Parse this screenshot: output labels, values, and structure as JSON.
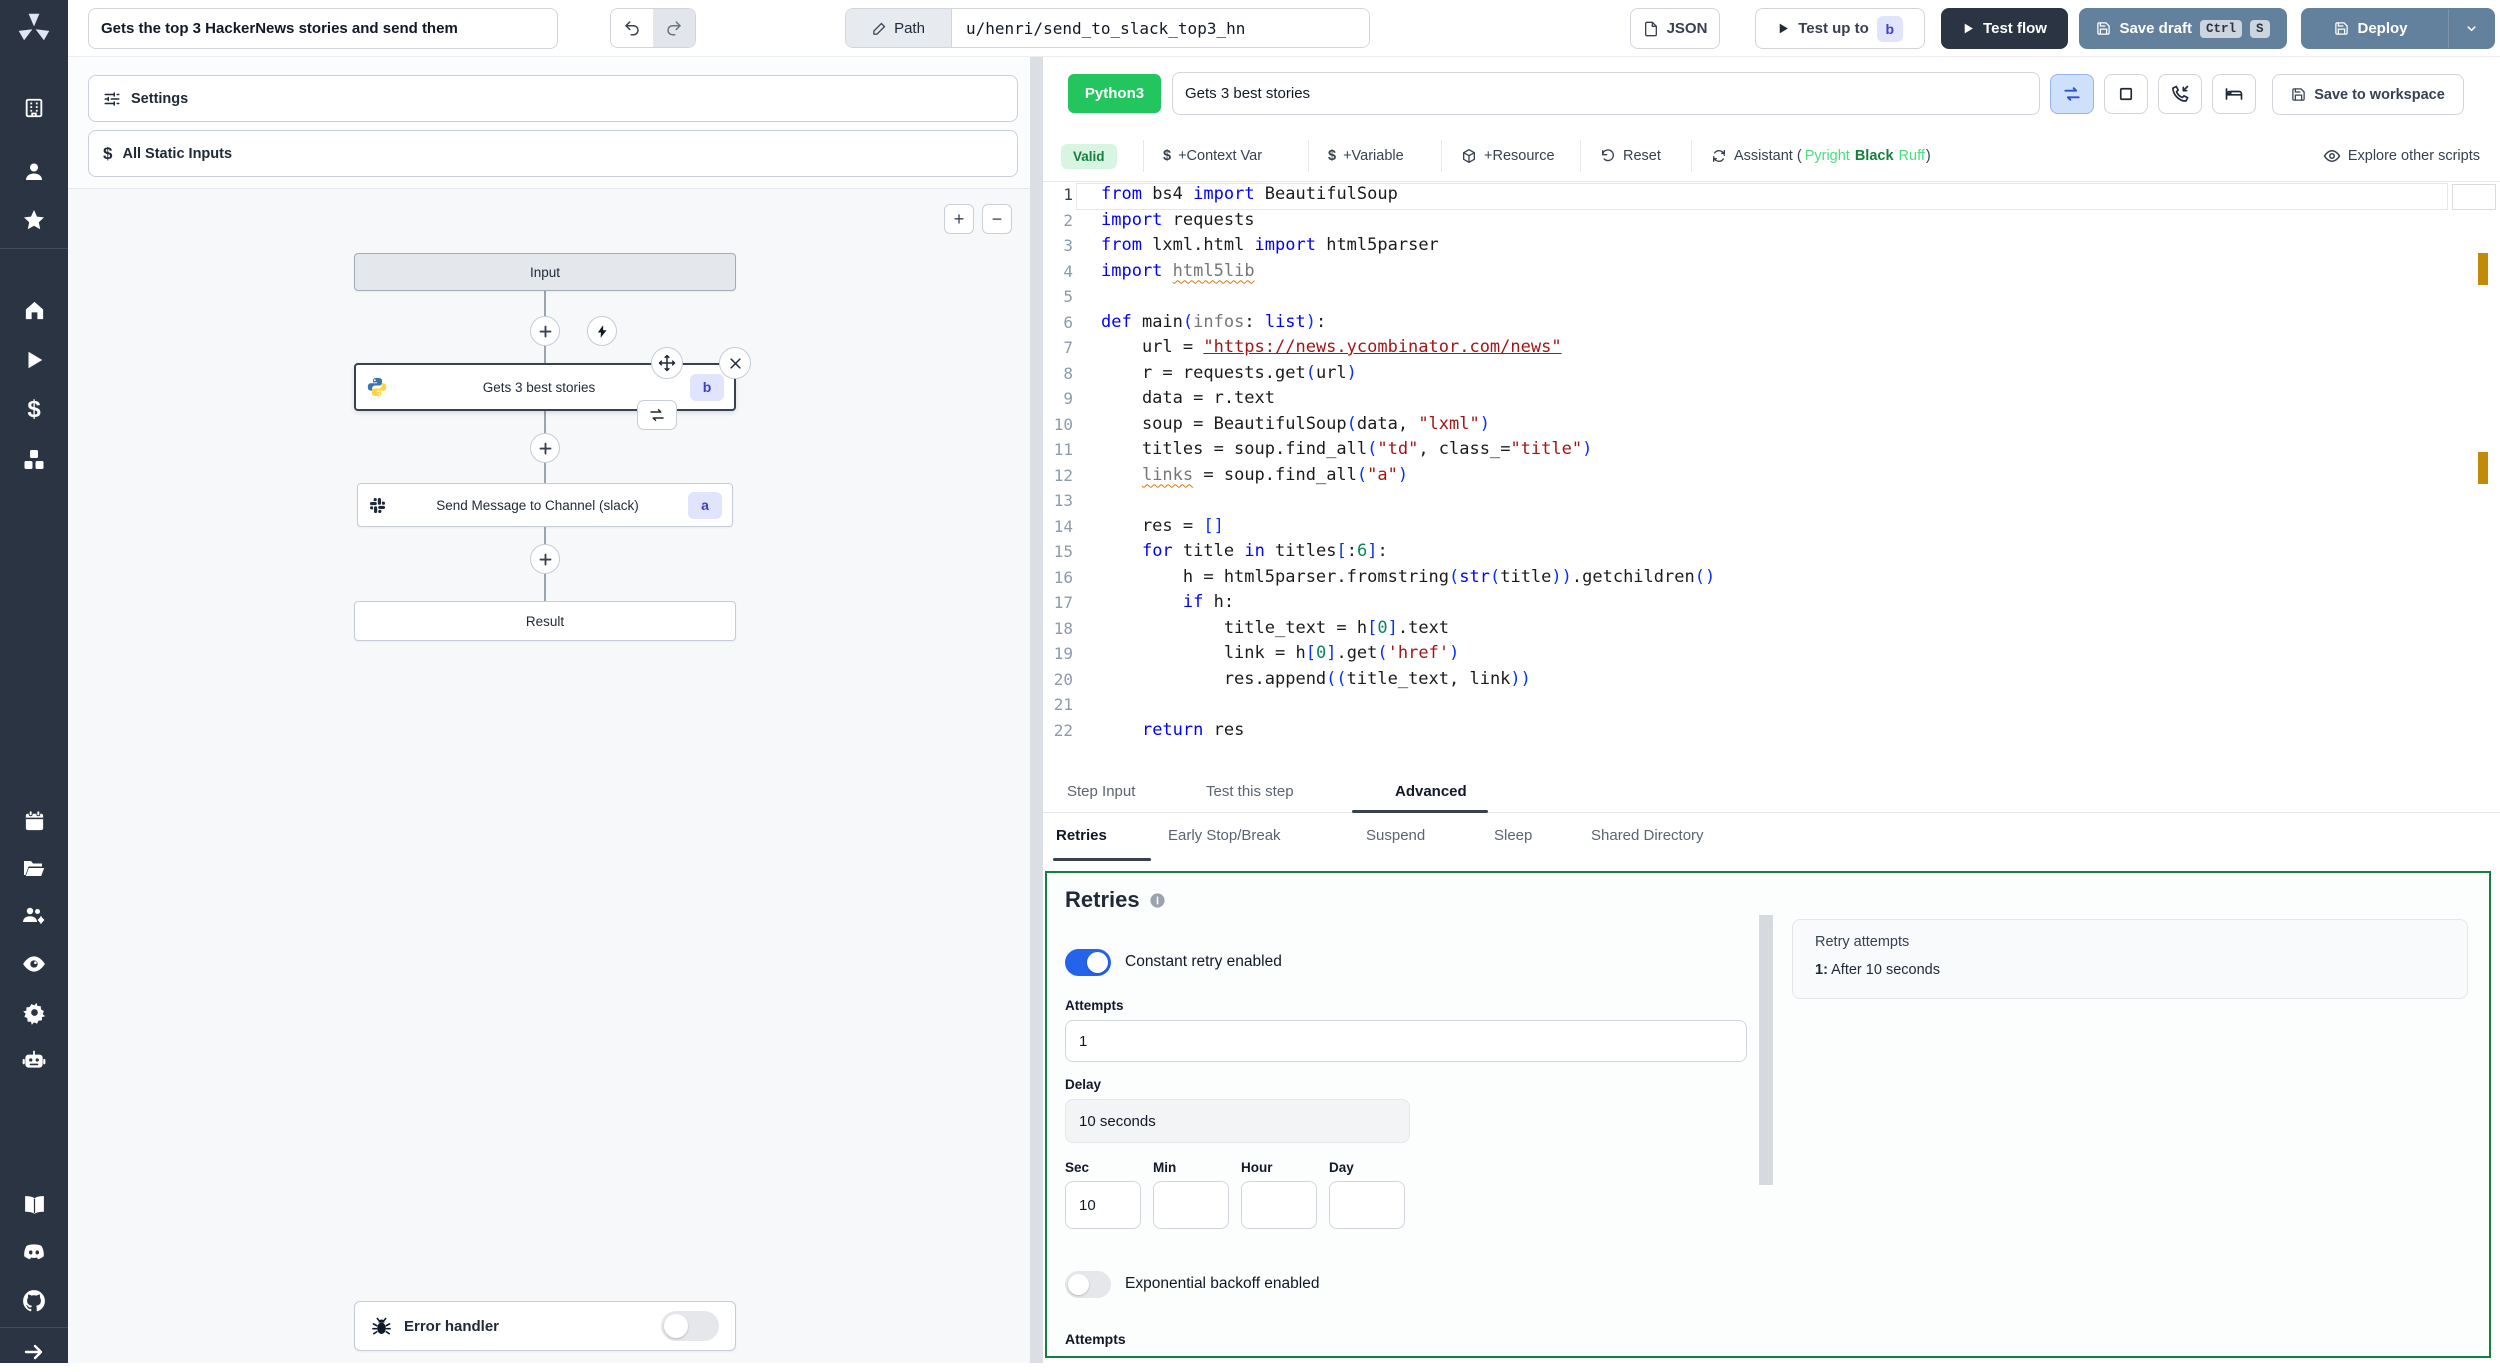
{
  "colors": {
    "accent_green": "#15803d",
    "python_badge_green": "#22c55e",
    "toggle_blue": "#2563eb",
    "steel_button": "#63809c",
    "dark_navy": "#2b3442",
    "badge_indigo_bg": "#e0e4fc",
    "badge_indigo_text": "#4040c8",
    "warning_amber": "#bf8803",
    "valid_bg": "#d8f5e3",
    "valid_text": "#15803d"
  },
  "sidebar": {
    "icons": [
      "windmill-logo",
      "building-icon",
      "user-icon",
      "star-icon",
      "home-icon",
      "play-icon",
      "dollar-icon",
      "cubes-icon",
      "calendar-icon",
      "folder-icon",
      "user-group-gear-icon",
      "eye-icon",
      "gear-icon",
      "robot-icon",
      "book-icon",
      "discord-icon",
      "github-icon",
      "arrow-right-icon"
    ]
  },
  "topbar": {
    "flow_title": "Gets the top 3 HackerNews stories and send them",
    "path_label": "Path",
    "path_value": "u/henri/send_to_slack_top3_hn",
    "json_button": "JSON",
    "test_up_to": "Test up to",
    "test_up_to_badge": "b",
    "test_flow": "Test flow",
    "save_draft": "Save draft",
    "kbd": [
      "Ctrl",
      "S"
    ],
    "deploy": "Deploy"
  },
  "flow": {
    "settings_label": "Settings",
    "static_inputs_label": "All Static Inputs",
    "zoom_in": "+",
    "zoom_out": "−",
    "nodes": {
      "input": "Input",
      "step_b": {
        "label": "Gets 3 best stories",
        "badge": "b"
      },
      "step_a": {
        "label": "Send Message to Channel (slack)",
        "badge": "a"
      },
      "result": "Result",
      "error_handler": "Error handler"
    }
  },
  "editor": {
    "language": "Python3",
    "step_name": "Gets 3 best stories",
    "save_to_workspace": "Save to workspace",
    "toolbar": {
      "valid": "Valid",
      "context_var": "+Context Var",
      "variable": "+Variable",
      "resource": "+Resource",
      "reset": "Reset",
      "assistant_prefix": "Assistant (",
      "assistant_tools": [
        "Pyright",
        "Black",
        "Ruff"
      ],
      "assistant_suffix": ")",
      "explore": "Explore other scripts"
    },
    "code_lines": [
      [
        [
          "k",
          "from"
        ],
        [
          "p",
          " bs4 "
        ],
        [
          "k",
          "import"
        ],
        [
          "p",
          " BeautifulSoup"
        ]
      ],
      [
        [
          "k",
          "import"
        ],
        [
          "p",
          " requests"
        ]
      ],
      [
        [
          "k",
          "from"
        ],
        [
          "p",
          " lxml.html "
        ],
        [
          "k",
          "import"
        ],
        [
          "p",
          " html5parser"
        ]
      ],
      [
        [
          "k",
          "import"
        ],
        [
          "p",
          " "
        ],
        [
          "gs",
          "html5lib"
        ]
      ],
      [],
      [
        [
          "k",
          "def"
        ],
        [
          "p",
          " main"
        ],
        [
          "b",
          "("
        ],
        [
          "g",
          "infos"
        ],
        [
          "p",
          ": "
        ],
        [
          "k",
          "list"
        ],
        [
          "b",
          ")"
        ],
        [
          "p",
          ":"
        ]
      ],
      [
        [
          "p",
          "    url = "
        ],
        [
          "su",
          "\"https://news.ycombinator.com/news\""
        ]
      ],
      [
        [
          "p",
          "    r = requests.get"
        ],
        [
          "b",
          "("
        ],
        [
          "p",
          "url"
        ],
        [
          "b",
          ")"
        ]
      ],
      [
        [
          "p",
          "    data = r.text"
        ]
      ],
      [
        [
          "p",
          "    soup = BeautifulSoup"
        ],
        [
          "b",
          "("
        ],
        [
          "p",
          "data, "
        ],
        [
          "s",
          "\"lxml\""
        ],
        [
          "b",
          ")"
        ]
      ],
      [
        [
          "p",
          "    titles = soup.find_all"
        ],
        [
          "b",
          "("
        ],
        [
          "s",
          "\"td\""
        ],
        [
          "p",
          ", class_="
        ],
        [
          "s",
          "\"title\""
        ],
        [
          "b",
          ")"
        ]
      ],
      [
        [
          "p",
          "    "
        ],
        [
          "gs",
          "links"
        ],
        [
          "p",
          " = soup.find_all"
        ],
        [
          "b",
          "("
        ],
        [
          "s",
          "\"a\""
        ],
        [
          "b",
          ")"
        ]
      ],
      [],
      [
        [
          "p",
          "    res = "
        ],
        [
          "b",
          "[]"
        ]
      ],
      [
        [
          "k",
          "for"
        ],
        [
          "p",
          " title "
        ],
        [
          "k",
          "in"
        ],
        [
          "p",
          " titles"
        ],
        [
          "b",
          "["
        ],
        [
          "p",
          ":"
        ],
        [
          "n",
          "6"
        ],
        [
          "b",
          "]"
        ],
        [
          "p",
          ":"
        ]
      ],
      [
        [
          "p",
          "        h = html5parser.fromstring"
        ],
        [
          "b",
          "("
        ],
        [
          "k",
          "str"
        ],
        [
          "b",
          "("
        ],
        [
          "p",
          "title"
        ],
        [
          "b",
          "))"
        ],
        [
          "p",
          ".getchildren"
        ],
        [
          "b",
          "()"
        ]
      ],
      [
        [
          "p",
          "        "
        ],
        [
          "k",
          "if"
        ],
        [
          "p",
          " h:"
        ]
      ],
      [
        [
          "p",
          "            title_text = h"
        ],
        [
          "b",
          "["
        ],
        [
          "n",
          "0"
        ],
        [
          "b",
          "]"
        ],
        [
          "p",
          ".text"
        ]
      ],
      [
        [
          "p",
          "            link = h"
        ],
        [
          "b",
          "["
        ],
        [
          "n",
          "0"
        ],
        [
          "b",
          "]"
        ],
        [
          "p",
          ".get"
        ],
        [
          "b",
          "("
        ],
        [
          "s",
          "'href'"
        ],
        [
          "b",
          ")"
        ]
      ],
      [
        [
          "p",
          "            res.append"
        ],
        [
          "b",
          "(("
        ],
        [
          "p",
          "title_text, link"
        ],
        [
          "b",
          "))"
        ]
      ],
      [],
      [
        [
          "p",
          "    "
        ],
        [
          "k",
          "return"
        ],
        [
          "p",
          " res"
        ]
      ]
    ],
    "code_indent_fix": "line 15 begins with 4 spaces",
    "status_icons": [
      "repeat-icon",
      "stop-square-icon",
      "phone-incoming-icon",
      "bed-icon"
    ]
  },
  "tabs": {
    "main": [
      "Step Input",
      "Test this step",
      "Advanced"
    ],
    "main_active": "Advanced",
    "sub": [
      "Retries",
      "Early Stop/Break",
      "Suspend",
      "Sleep",
      "Shared Directory"
    ],
    "sub_active": "Retries"
  },
  "retries": {
    "title": "Retries",
    "constant_label": "Constant retry enabled",
    "attempts_label": "Attempts",
    "attempts_value": "1",
    "delay_label": "Delay",
    "delay_value": "10 seconds",
    "units": [
      "Sec",
      "Min",
      "Hour",
      "Day"
    ],
    "sec_value": "10",
    "min_value": "",
    "hour_value": "",
    "day_value": "",
    "expo_label": "Exponential backoff enabled",
    "attempts2_label": "Attempts",
    "summary": {
      "title": "Retry attempts",
      "item_index": "1:",
      "item_text": "After 10 seconds"
    }
  }
}
